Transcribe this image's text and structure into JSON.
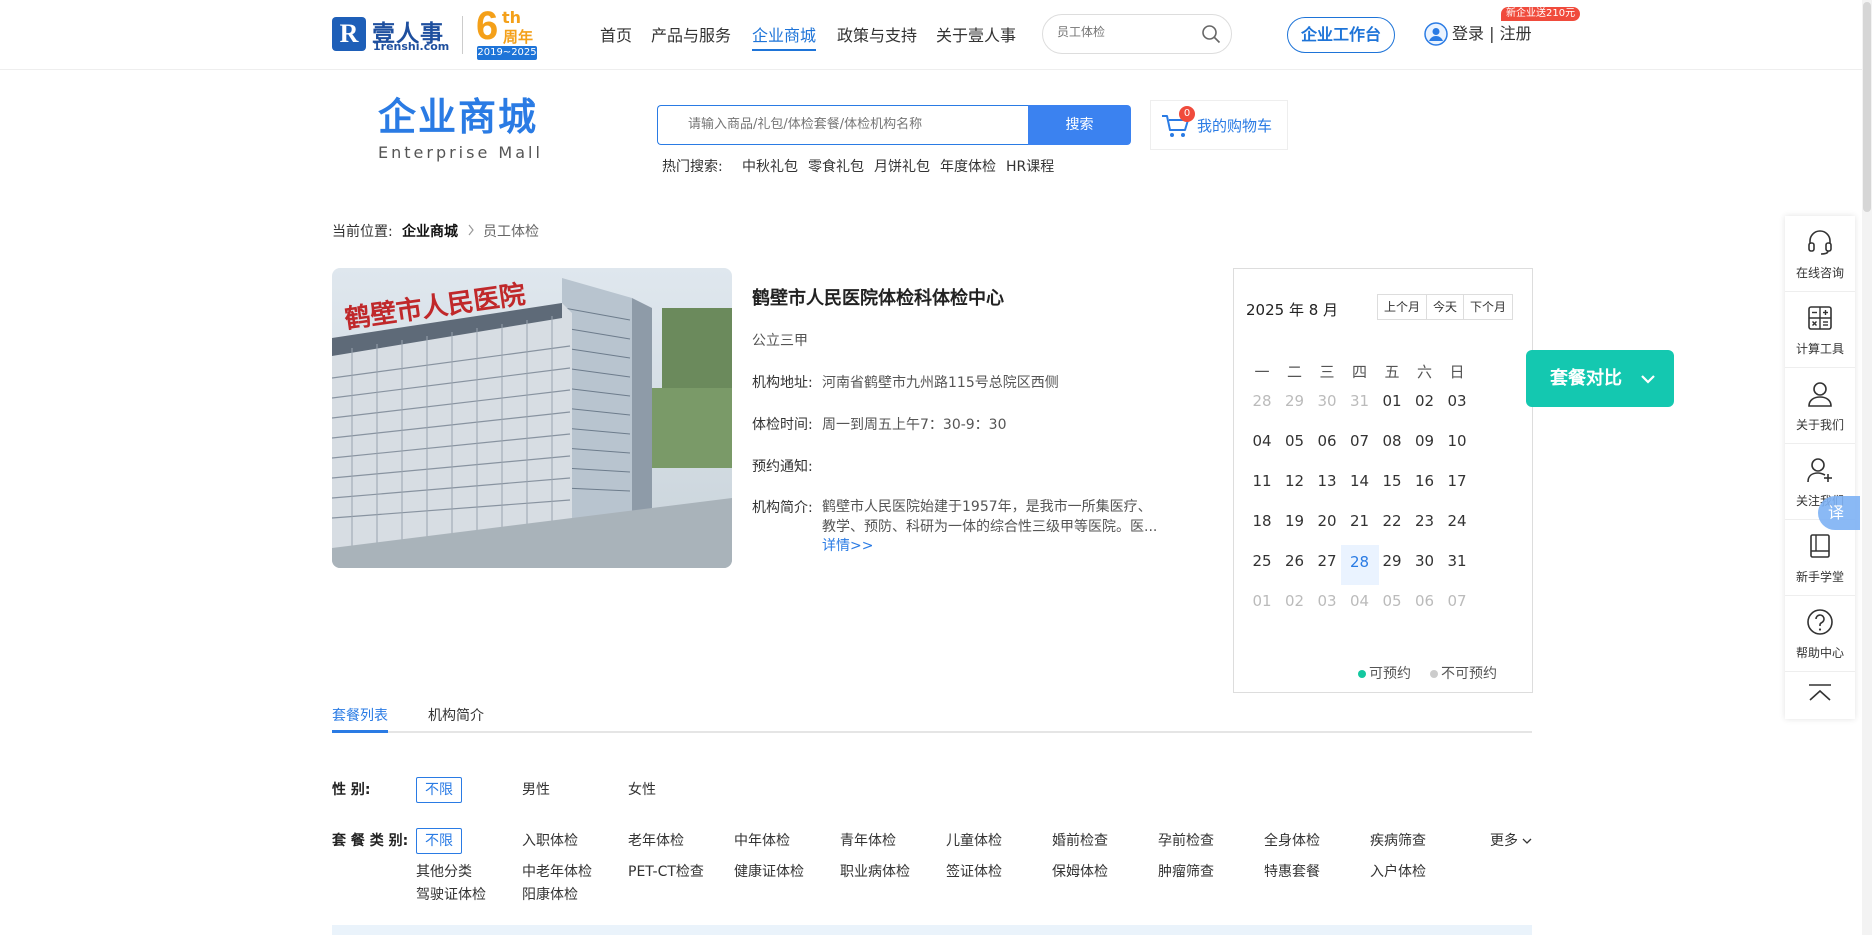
{
  "header": {
    "logo_text": "壹人事",
    "logo_domain": "1renshi.com",
    "anniversary": {
      "number": "6",
      "suffix": "th",
      "text": "周年",
      "years": "2019~2025"
    },
    "nav": [
      "首页",
      "产品与服务",
      "企业商城",
      "政策与支持",
      "关于壹人事"
    ],
    "active_nav": "企业商城",
    "search_placeholder": "员工体检",
    "workbench_label": "企业工作台",
    "login_label": "登录 | 注册",
    "promo_badge": "新企业送210元"
  },
  "mall": {
    "title": "企业商城",
    "subtitle": "Enterprise  Mall",
    "search_placeholder": "请输入商品/礼包/体检套餐/体检机构名称",
    "search_button": "搜索",
    "cart_label": "我的购物车",
    "cart_count": "0",
    "hot_label": "热门搜索:",
    "hot_items": [
      "中秋礼包",
      "零食礼包",
      "月饼礼包",
      "年度体检",
      "HR课程"
    ]
  },
  "breadcrumb": {
    "prefix": "当前位置:",
    "items": [
      "企业商城",
      "员工体检"
    ]
  },
  "institution": {
    "image_sign": "鹤壁市人民医院",
    "name": "鹤壁市人民医院体检科体检中心",
    "grade": "公立三甲",
    "address_label": "机构地址:",
    "address": "河南省鹤壁市九州路115号总院区西侧",
    "hours_label": "体检时间:",
    "hours": "周一到周五上午7：30-9：30",
    "notice_label": "预约通知:",
    "notice": "",
    "intro_label": "机构简介:",
    "intro": "鹤壁市人民医院始建于1957年，是我市一所集医疗、教学、预防、科研为一体的综合性三级甲等医院。医...",
    "more_label": "详情>>"
  },
  "calendar": {
    "title": "2025 年 8 月",
    "buttons": [
      "上个月",
      "今天",
      "下个月"
    ],
    "weekdays": [
      "一",
      "二",
      "三",
      "四",
      "五",
      "六",
      "日"
    ],
    "weeks": [
      [
        "28",
        "29",
        "30",
        "31",
        "01",
        "02",
        "03"
      ],
      [
        "04",
        "05",
        "06",
        "07",
        "08",
        "09",
        "10"
      ],
      [
        "11",
        "12",
        "13",
        "14",
        "15",
        "16",
        "17"
      ],
      [
        "18",
        "19",
        "20",
        "21",
        "22",
        "23",
        "24"
      ],
      [
        "25",
        "26",
        "27",
        "28",
        "29",
        "30",
        "31"
      ],
      [
        "01",
        "02",
        "03",
        "04",
        "05",
        "06",
        "07"
      ]
    ],
    "today": "28",
    "legend_available": "可预约",
    "legend_unavailable": "不可预约",
    "color_available": "#14c8a0",
    "color_unavailable": "#cccccc"
  },
  "compare_button": "套餐对比",
  "right_rail": [
    {
      "label": "在线咨询",
      "icon": "headset-icon"
    },
    {
      "label": "计算工具",
      "icon": "calculator-icon"
    },
    {
      "label": "关于我们",
      "icon": "person-icon"
    },
    {
      "label": "关注我们",
      "icon": "person-add-icon"
    },
    {
      "label": "新手学堂",
      "icon": "book-icon"
    },
    {
      "label": "帮助中心",
      "icon": "help-icon"
    }
  ],
  "translate_label": "译",
  "tabs": [
    "套餐列表",
    "机构简介"
  ],
  "filters": {
    "gender_label": "性        别:",
    "gender_options": [
      "不限",
      "男性",
      "女性"
    ],
    "category_label": "套 餐 类 别:",
    "category_row1": [
      "不限",
      "入职体检",
      "老年体检",
      "中年体检",
      "青年体检",
      "儿童体检",
      "婚前检查",
      "孕前检查",
      "全身体检",
      "疾病筛查"
    ],
    "category_row2": [
      "其他分类",
      "中老年体检",
      "PET-CT检查",
      "健康证体检",
      "职业病体检",
      "签证体检",
      "保姆体检",
      "肿瘤筛查",
      "特惠套餐",
      "入户体检"
    ],
    "category_row3": [
      "驾驶证体检",
      "阳康体检"
    ],
    "more_label": "更多"
  },
  "colors": {
    "primary": "#2a7be4",
    "accent_teal": "#14c8b0",
    "anniversary_orange": "#f4a019",
    "badge_red": "#f04b3c"
  }
}
